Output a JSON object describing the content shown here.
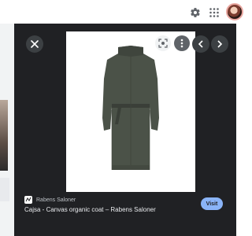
{
  "header": {
    "icons": [
      "gear-icon",
      "apps-grid-icon",
      "account-avatar"
    ]
  },
  "viewer": {
    "source_name": "Rabens Saloner",
    "caption": "Cajsa - Canvas organic coat – Rabens Saloner",
    "visit_label": "Visit",
    "icons": [
      "close-icon",
      "lens-icon",
      "more-vert-icon",
      "chevron-left-icon",
      "chevron-right-icon"
    ],
    "colors": {
      "panel_bg": "#202124",
      "visit_button": "#8ab4f8",
      "coat": "#4b5248"
    }
  }
}
